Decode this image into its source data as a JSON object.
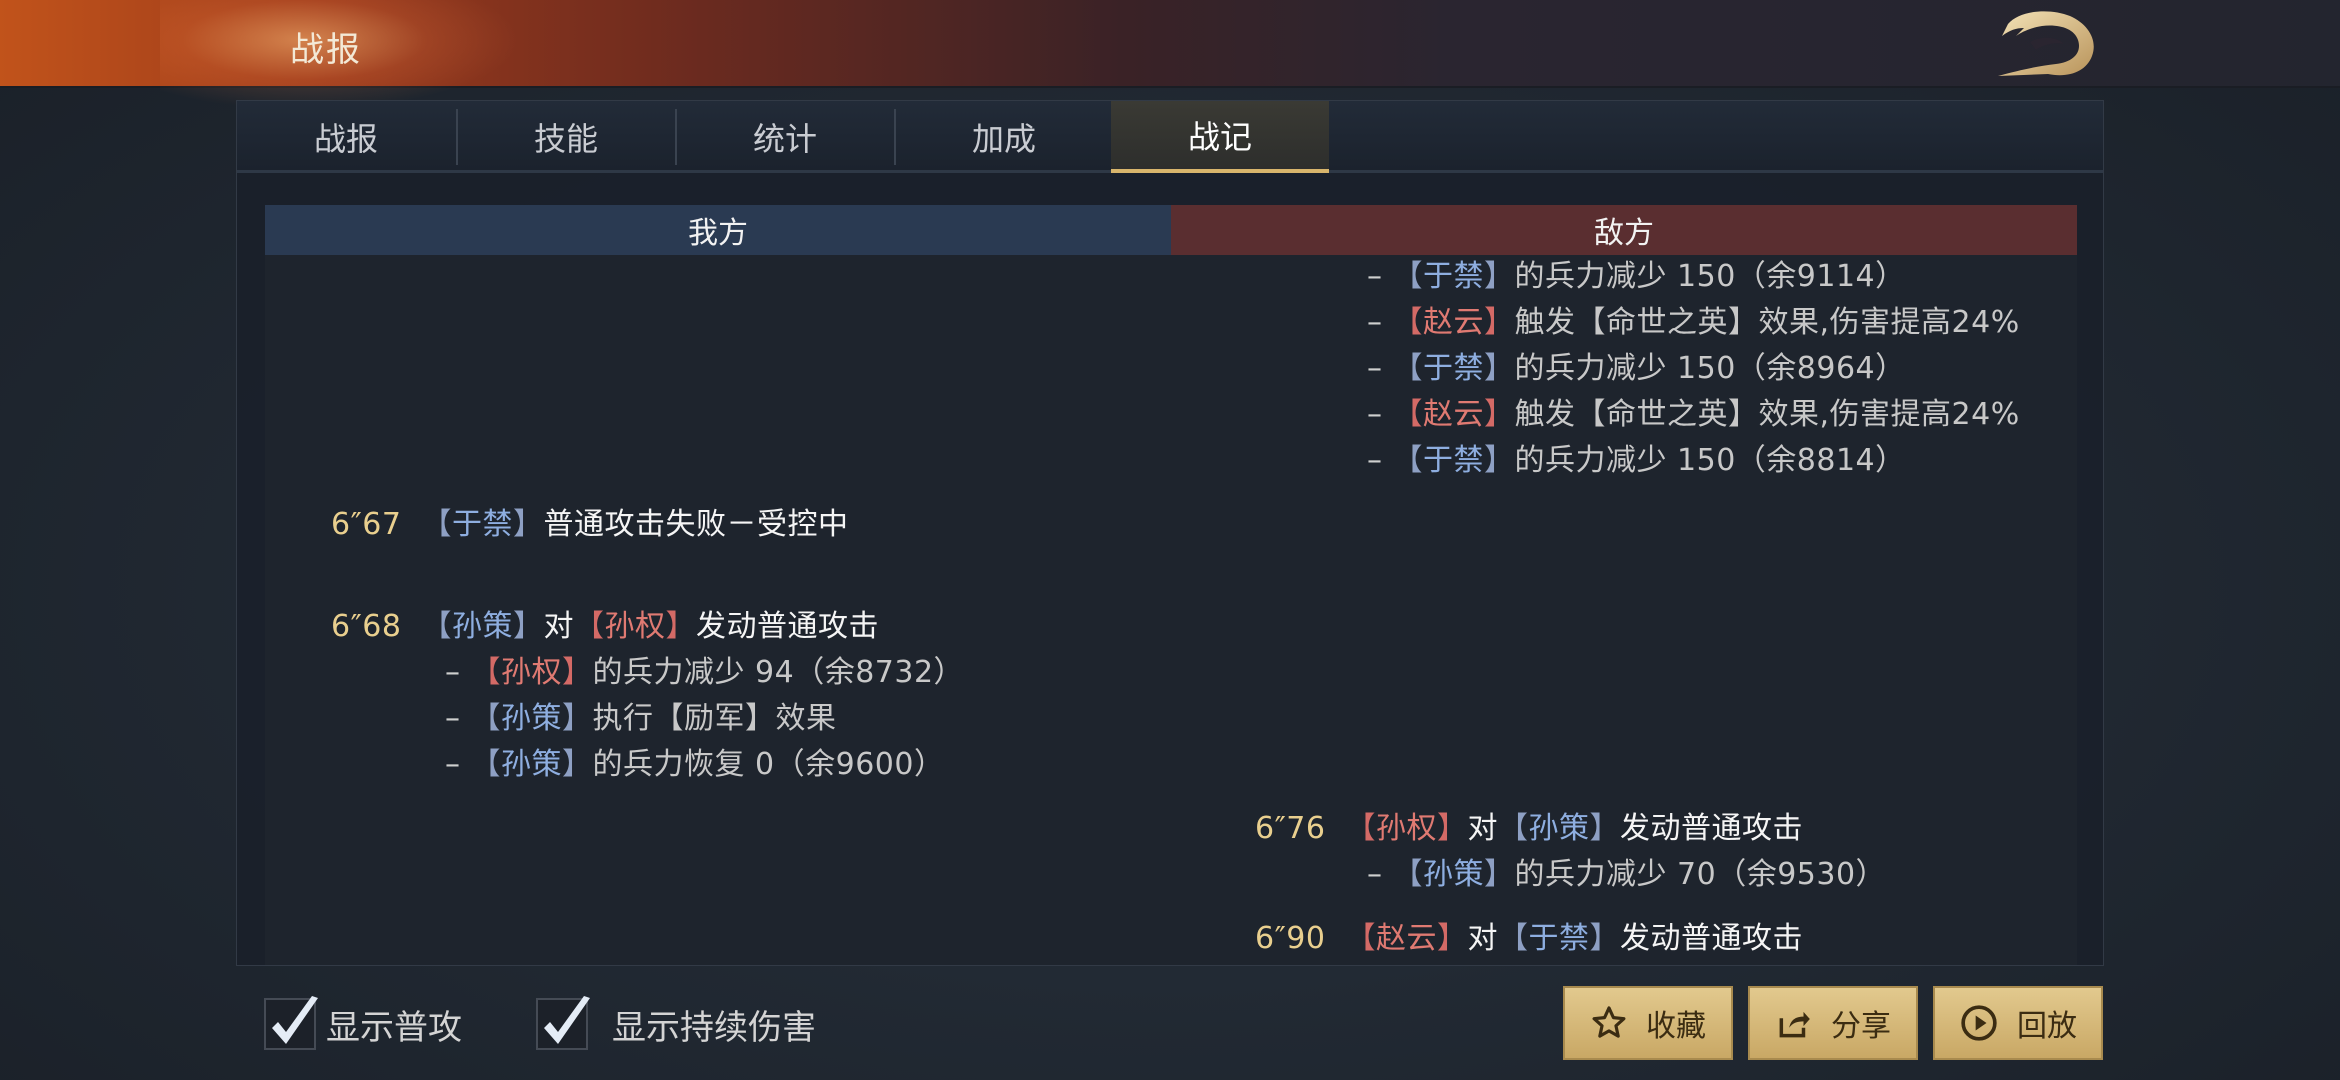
{
  "header": {
    "title": "战报"
  },
  "tabs": [
    {
      "label": "战报"
    },
    {
      "label": "技能"
    },
    {
      "label": "统计"
    },
    {
      "label": "加成"
    },
    {
      "label": "战记",
      "active": true
    }
  ],
  "sides": {
    "ours": "我方",
    "enemy": "敌方"
  },
  "log": {
    "e1": {
      "dash": "–",
      "lb": "【",
      "name": "于禁",
      "rb": "】",
      "text": "的兵力减少 150（余9114）"
    },
    "e2": {
      "dash": "–",
      "lb": "【",
      "name": "赵云",
      "rb": "】",
      "text1": "触发【",
      "skill": "命世之英",
      "text2": "】效果,伤害提高24%"
    },
    "e3": {
      "dash": "–",
      "lb": "【",
      "name": "于禁",
      "rb": "】",
      "text": "的兵力减少 150（余8964）"
    },
    "e4": {
      "dash": "–",
      "lb": "【",
      "name": "赵云",
      "rb": "】",
      "text1": "触发【",
      "skill": "命世之英",
      "text2": "】效果,伤害提高24%"
    },
    "e5": {
      "dash": "–",
      "lb": "【",
      "name": "于禁",
      "rb": "】",
      "text": "的兵力减少 150（余8814）"
    },
    "a1": {
      "time": "6″67",
      "lb": "【",
      "name": "于禁",
      "rb": "】",
      "text": "普通攻击失败－受控中"
    },
    "a2": {
      "time": "6″68",
      "lb1": "【",
      "name1": "孙策",
      "rb1": "】",
      "mid": "对",
      "lb2": "【",
      "name2": "孙权",
      "rb2": "】",
      "text": "发动普通攻击"
    },
    "a3": {
      "dash": "–",
      "lb": "【",
      "name": "孙权",
      "rb": "】",
      "text": "的兵力减少 94（余8732）"
    },
    "a4": {
      "dash": "–",
      "lb": "【",
      "name": "孙策",
      "rb": "】",
      "text1": "执行【",
      "skill": "励军",
      "text2": "】效果"
    },
    "a5": {
      "dash": "–",
      "lb": "【",
      "name": "孙策",
      "rb": "】",
      "text": "的兵力恢复 0（余9600）"
    },
    "b1": {
      "time": "6″76",
      "lb1": "【",
      "name1": "孙权",
      "rb1": "】",
      "mid": "对",
      "lb2": "【",
      "name2": "孙策",
      "rb2": "】",
      "text": "发动普通攻击"
    },
    "b2": {
      "dash": "–",
      "lb": "【",
      "name": "孙策",
      "rb": "】",
      "text": "的兵力减少 70（余9530）"
    },
    "b3": {
      "time": "6″90",
      "lb1": "【",
      "name1": "赵云",
      "rb1": "】",
      "mid": "对",
      "lb2": "【",
      "name2": "于禁",
      "rb2": "】",
      "text": "发动普通攻击"
    }
  },
  "options": {
    "show_normal_attack": {
      "label": "显示普攻",
      "checked": true
    },
    "show_dot": {
      "label": "显示持续伤害",
      "checked": true
    }
  },
  "buttons": {
    "favorite": {
      "label": "收藏",
      "icon": "star-icon"
    },
    "share": {
      "label": "分享",
      "icon": "share-icon"
    },
    "replay": {
      "label": "回放",
      "icon": "play-icon"
    }
  },
  "colors": {
    "ally": "#8eaee0",
    "enemy": "#e07a72",
    "time": "#e9cf8e",
    "gold": "#d8b56c"
  }
}
